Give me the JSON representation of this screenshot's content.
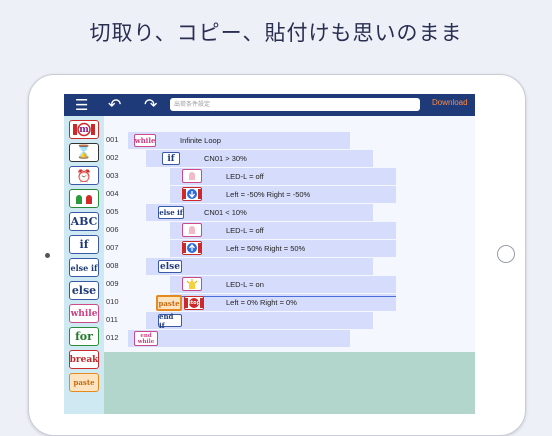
{
  "headline": "切取り、コピー、貼付けも思いのまま",
  "toolbar": {
    "menu_glyph": "☰",
    "undo_glyph": "↶",
    "redo_glyph": "↷",
    "search_placeholder": "出荷条件設定",
    "download_label": "Download"
  },
  "palette": [
    {
      "name": "motor-block",
      "label": "m"
    },
    {
      "name": "timer-block",
      "label": "⌛"
    },
    {
      "name": "alarm-block",
      "label": "⏰"
    },
    {
      "name": "led-block",
      "label": ""
    },
    {
      "name": "abc-block",
      "label": "ABC"
    },
    {
      "name": "if-block",
      "label": "if"
    },
    {
      "name": "elseif-block",
      "label": "else if"
    },
    {
      "name": "else-block",
      "label": "else"
    },
    {
      "name": "while-block",
      "label": "while"
    },
    {
      "name": "for-block",
      "label": "for"
    },
    {
      "name": "break-block",
      "label": "break"
    },
    {
      "name": "paste-block",
      "label": "paste"
    }
  ],
  "lines": [
    {
      "num": "001",
      "block": "while",
      "desc": "Infinite Loop"
    },
    {
      "num": "002",
      "block": "if",
      "desc": "CN01 > 30%"
    },
    {
      "num": "003",
      "block": "",
      "desc": "LED-L = off"
    },
    {
      "num": "004",
      "block": "",
      "desc": "Left = -50%   Right = -50%"
    },
    {
      "num": "005",
      "block": "else if",
      "desc": "CN01 < 10%"
    },
    {
      "num": "006",
      "block": "",
      "desc": "LED-L = off"
    },
    {
      "num": "007",
      "block": "",
      "desc": "Left = 50%   Right = 50%"
    },
    {
      "num": "008",
      "block": "else",
      "desc": ""
    },
    {
      "num": "009",
      "block": "",
      "desc": "LED-L = on"
    },
    {
      "num": "010",
      "block": "paste",
      "block2": "stop",
      "desc": "Left = 0%    Right = 0%"
    },
    {
      "num": "011",
      "block": "end if",
      "desc": ""
    },
    {
      "num": "012",
      "block": "end while",
      "desc": ""
    }
  ],
  "colors": {
    "toolbar": "#1f3a78",
    "download": "#ff8a3d",
    "editor_bg": "#f5f7ff",
    "row_bar": "#d6dcfb",
    "screen_bg": "#b3d6cc"
  }
}
